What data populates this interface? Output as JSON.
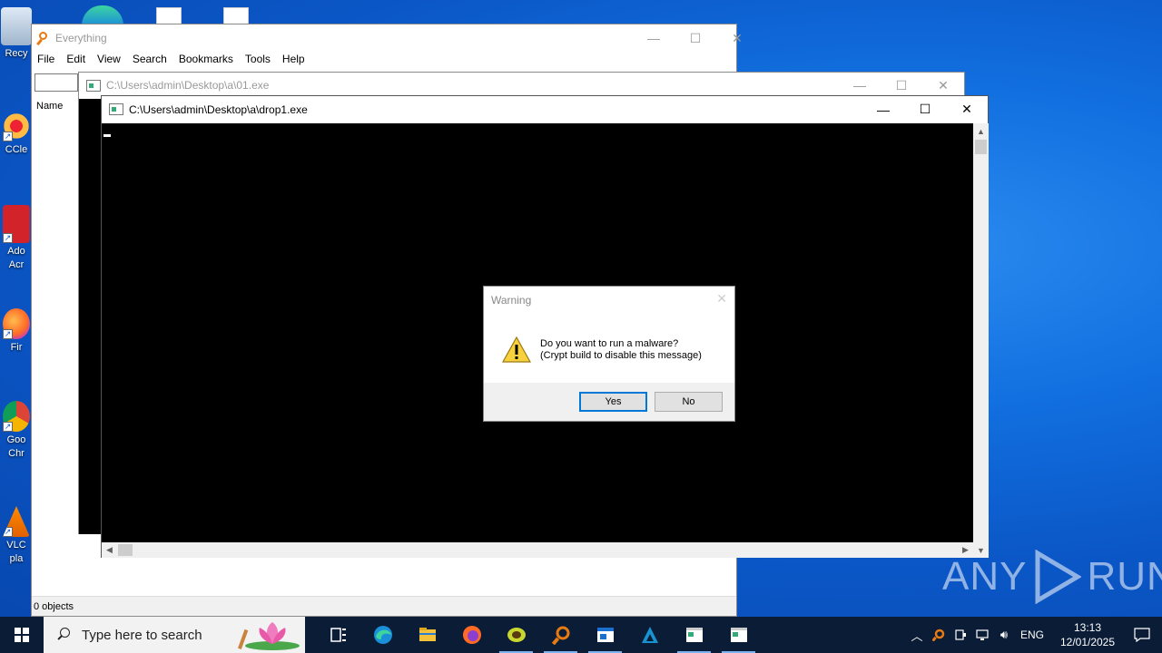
{
  "desktop": {
    "icons": [
      {
        "label": "Recy",
        "icon": "recycle-bin-icon"
      },
      {
        "label": "CCle",
        "icon": "ccleaner-icon"
      },
      {
        "label": "Ado\nAcr",
        "icon": "adobe-acrobat-icon"
      },
      {
        "label": "Fir",
        "icon": "firefox-icon"
      },
      {
        "label": "Goo\nChr",
        "icon": "chrome-icon"
      },
      {
        "label": "VLC\npla",
        "icon": "vlc-icon"
      }
    ]
  },
  "everything_window": {
    "title": "Everything",
    "menu": [
      "File",
      "Edit",
      "View",
      "Search",
      "Bookmarks",
      "Tools",
      "Help"
    ],
    "column_name": "Name",
    "status": "0 objects"
  },
  "console_back": {
    "title": "C:\\Users\\admin\\Desktop\\a\\01.exe"
  },
  "console_front": {
    "title": "C:\\Users\\admin\\Desktop\\a\\drop1.exe"
  },
  "dialog": {
    "title": "Warning",
    "close": "✕",
    "message_line1": "Do you want to run a malware?",
    "message_line2": "(Crypt build to disable this message)",
    "yes_label": "Yes",
    "no_label": "No"
  },
  "taskbar": {
    "search_placeholder": "Type here to search",
    "apps": [
      "task-view-icon",
      "edge-icon",
      "file-explorer-icon",
      "firefox-icon",
      "winrar-icon",
      "everything-icon",
      "window-app-icon",
      "arch-icon",
      "console-icon",
      "console-icon"
    ],
    "language": "ENG",
    "time": "13:13",
    "date": "12/01/2025"
  },
  "watermark": {
    "left": "ANY",
    "right": "RUN"
  },
  "colors": {
    "accent": "#0078d7",
    "desktop": "#0b57c7",
    "taskbar": "#0a1c36"
  }
}
